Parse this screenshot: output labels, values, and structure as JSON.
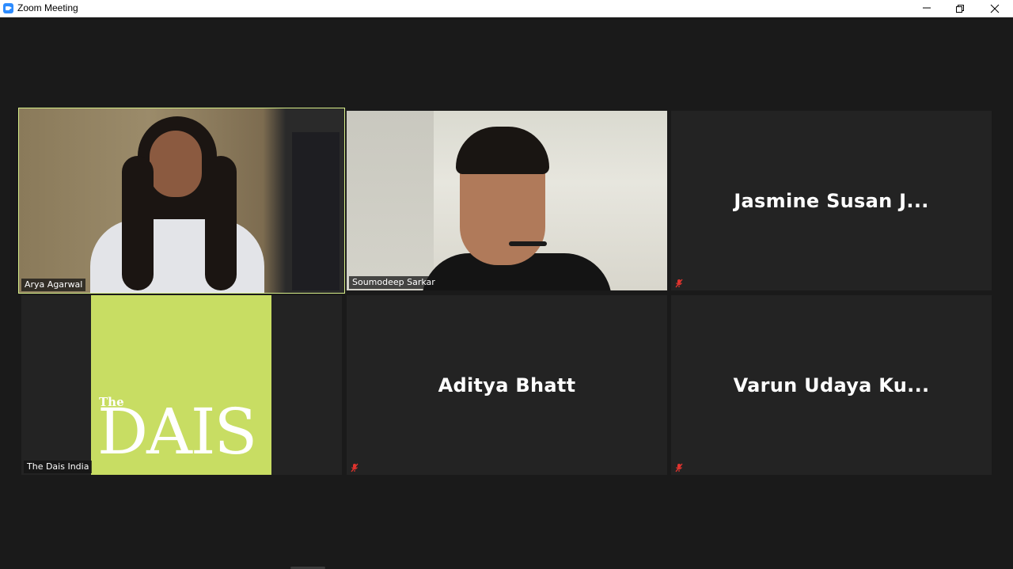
{
  "window": {
    "title": "Zoom Meeting",
    "minimize_label": "Minimize",
    "restore_label": "Restore",
    "close_label": "Close"
  },
  "participants": [
    {
      "name": "Arya Agarwal",
      "video": true,
      "active_speaker": true
    },
    {
      "name": "Soumodeep Sarkar",
      "video": true,
      "active_speaker": false
    },
    {
      "name": "Jasmine Susan J...",
      "video": false,
      "muted": true
    },
    {
      "name": "The Dais India",
      "video": true,
      "logo_the": "The",
      "logo_word": "DAIS"
    },
    {
      "name": "Aditya Bhatt",
      "video": false,
      "muted": true
    },
    {
      "name": "Varun Udaya Ku...",
      "video": false,
      "muted": true
    }
  ],
  "colors": {
    "active_speaker_border": "#d7ee89",
    "dais_logo_bg": "#c8dd63",
    "muted_icon": "#e0332e",
    "tile_bg": "#232323",
    "stage_bg": "#1a1a1a"
  },
  "icons": {
    "app": "zoom-camera-icon",
    "muted": "microphone-muted-icon"
  }
}
